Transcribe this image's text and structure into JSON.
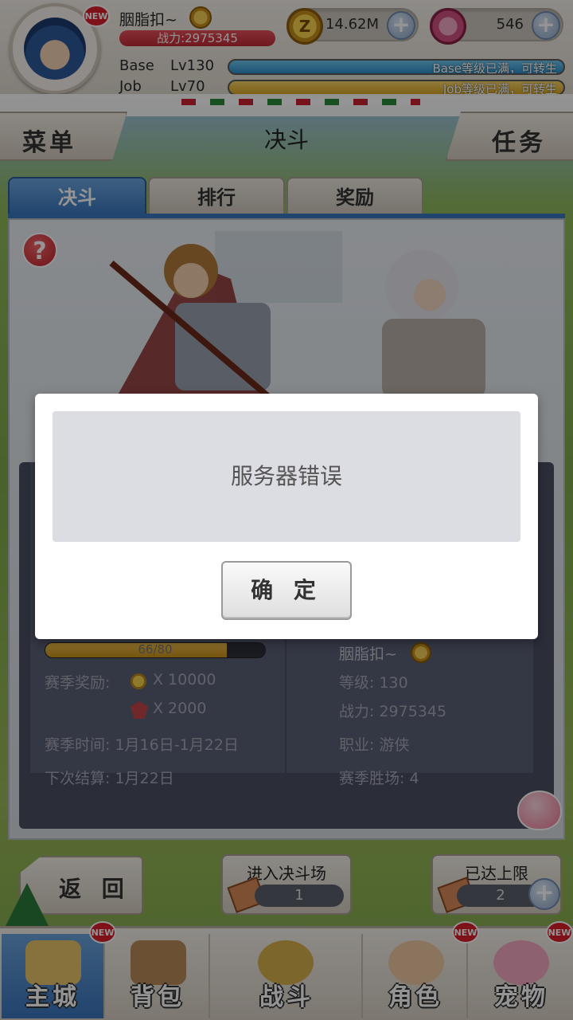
{
  "header": {
    "player_name": "胭脂扣~",
    "combat_power": "战力:2975345",
    "zeny": "14.62M",
    "gems": "546",
    "base_label": "Base",
    "base_level": "Lv130",
    "base_status": "Base等级已满，可转生",
    "job_label": "Job",
    "job_level": "Lv70",
    "job_status": "Job等级已满，可转生",
    "new_badge": "NEW"
  },
  "nav": {
    "menu": "菜单",
    "title": "决斗",
    "task": "任务"
  },
  "tabs": [
    {
      "label": "决斗",
      "active": true
    },
    {
      "label": "排行",
      "active": false
    },
    {
      "label": "奖励",
      "active": false
    }
  ],
  "help_icon": "?",
  "left_stats": {
    "progress_text": "66/80",
    "progress_fraction": 0.825,
    "season_reward_label": "赛季奖励:",
    "reward_zeny": "X 10000",
    "reward_badge": "X 2000",
    "season_time": "赛季时间: 1月16日-1月22日",
    "next_settle": "下次结算: 1月22日"
  },
  "right_stats": {
    "name": "胭脂扣~",
    "level": "等级: 130",
    "power": "战力: 2975345",
    "job": "职业: 游侠",
    "wins": "赛季胜场: 4"
  },
  "bottom_actions": {
    "back": "返 回",
    "enter_arena": "进入决斗场",
    "enter_count": "1",
    "limit_reached": "已达上限",
    "limit_count": "2"
  },
  "bottom_nav": [
    {
      "label": "主城",
      "active": true,
      "new": true
    },
    {
      "label": "背包",
      "active": false,
      "new": false
    },
    {
      "label": "战斗",
      "active": false,
      "new": false
    },
    {
      "label": "角色",
      "active": false,
      "new": true
    },
    {
      "label": "宠物",
      "active": false,
      "new": true
    }
  ],
  "dialog": {
    "message": "服务器错误",
    "confirm": "确 定"
  },
  "colors": {
    "accent_blue": "#3c78c0",
    "power_red": "#c8303a",
    "base_bar": "#2b8fc9",
    "job_bar": "#d9a623"
  }
}
